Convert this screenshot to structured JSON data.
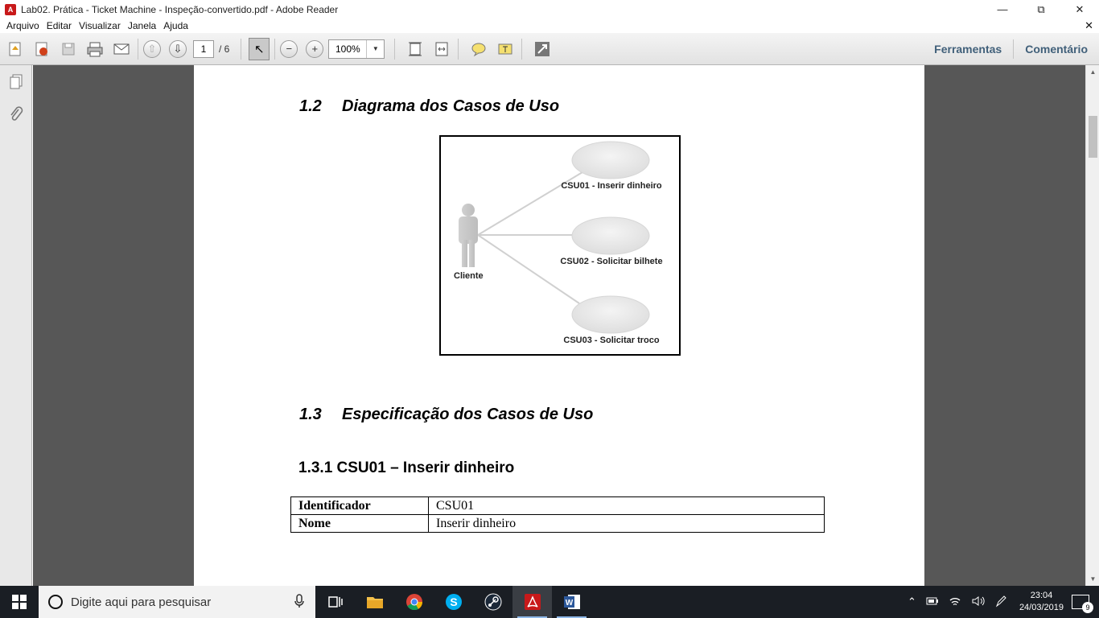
{
  "window": {
    "title": "Lab02. Prática - Ticket Machine - Inspeção-convertido.pdf - Adobe Reader"
  },
  "menu": [
    "Arquivo",
    "Editar",
    "Visualizar",
    "Janela",
    "Ajuda"
  ],
  "toolbar": {
    "page_current": "1",
    "page_total": "/ 6",
    "zoom": "100%",
    "tools_label": "Ferramentas",
    "comment_label": "Comentário"
  },
  "document": {
    "section_1_2": {
      "number": "1.2",
      "title": "Diagrama dos Casos de Uso"
    },
    "diagram": {
      "actor": "Cliente",
      "use_cases": [
        "CSU01 - Inserir dinheiro",
        "CSU02 - Solicitar bilhete",
        "CSU03 - Solicitar troco"
      ]
    },
    "section_1_3": {
      "number": "1.3",
      "title": "Especificação dos Casos de Uso"
    },
    "section_1_3_1": {
      "title": "1.3.1 CSU01 – Inserir dinheiro"
    },
    "table": [
      {
        "key": "Identificador",
        "value": "CSU01"
      },
      {
        "key": "Nome",
        "value": "Inserir dinheiro"
      }
    ]
  },
  "taskbar": {
    "search_placeholder": "Digite aqui para pesquisar",
    "time": "23:04",
    "date": "24/03/2019",
    "notifications": "9"
  }
}
